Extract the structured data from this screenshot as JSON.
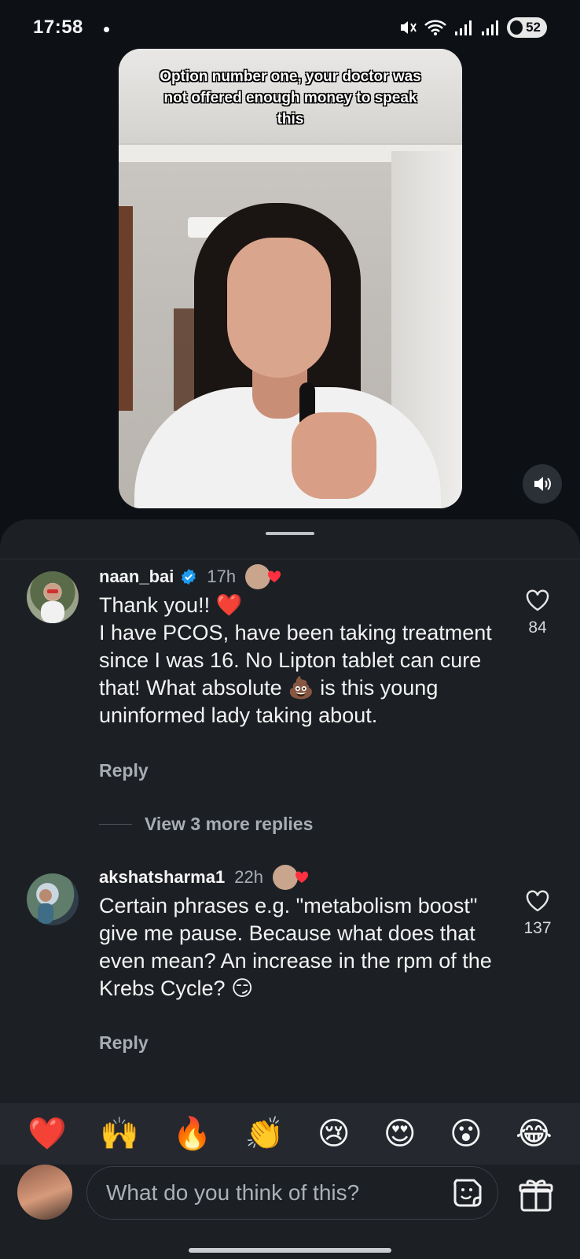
{
  "status_bar": {
    "time": "17:58",
    "battery": "52"
  },
  "video": {
    "caption": "Option number one, your doctor was not offered enough money to speak this"
  },
  "comments": [
    {
      "username": "naan_bai",
      "verified": true,
      "time": "17h",
      "text": "Thank you!! ❤️\nI have PCOS, have been taking treatment since I was 16. No Lipton tablet can cure that! What absolute 💩 is this young uninformed lady taking about.",
      "reply_label": "Reply",
      "like_count": "84",
      "view_replies": "View 3 more replies"
    },
    {
      "username": "akshatsharma1",
      "verified": false,
      "time": "22h",
      "text": "Certain phrases e.g. \"metabolism boost\" give me pause. Because what does that even mean? An increase in the rpm of the Krebs Cycle? 😏",
      "reply_label": "Reply",
      "like_count": "137"
    }
  ],
  "emoji_bar": [
    "❤️",
    "🙌",
    "🔥",
    "👏",
    "😢",
    "😍",
    "😮",
    "😂"
  ],
  "composer": {
    "placeholder": "What do you think of this?"
  },
  "icons": {
    "like": "heart-outline-icon",
    "verified": "verified-badge-icon",
    "sticker": "sticker-icon",
    "gift": "gift-icon",
    "sound": "speaker-icon"
  },
  "colors": {
    "background": "#0d1116",
    "sheet": "#1c1f24",
    "verified_blue": "#1d9bf0",
    "heart_red": "#ff3040"
  }
}
